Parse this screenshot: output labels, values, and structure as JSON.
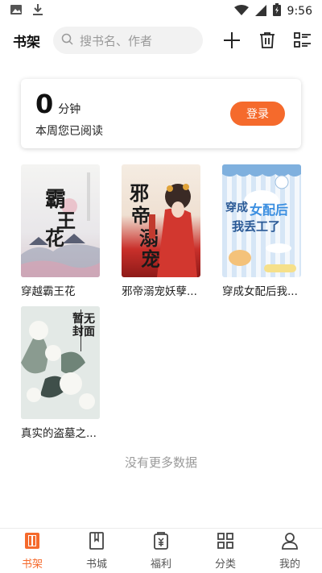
{
  "status_bar": {
    "time": "9:56"
  },
  "header": {
    "title": "书架",
    "search_placeholder": "搜书名、作者"
  },
  "reading_card": {
    "minutes": "0",
    "unit": "分钟",
    "week_label": "本周您已阅读",
    "login_label": "登录"
  },
  "books": [
    {
      "title": "穿越霸王花",
      "cover_text": "霸王花"
    },
    {
      "title": "邪帝溺宠妖孽...",
      "cover_text": "邪帝溺宠"
    },
    {
      "title": "穿成女配后我...",
      "cover_text": "穿成女配后我丢工了"
    },
    {
      "title": "真实的盗墓之...",
      "cover_text": "暂无封面"
    }
  ],
  "footer_text": "没有更多数据",
  "bottom_nav": [
    {
      "label": "书架",
      "icon": "bookshelf-icon",
      "active": true
    },
    {
      "label": "书城",
      "icon": "bookstore-icon",
      "active": false
    },
    {
      "label": "福利",
      "icon": "welfare-icon",
      "active": false
    },
    {
      "label": "分类",
      "icon": "category-icon",
      "active": false
    },
    {
      "label": "我的",
      "icon": "profile-icon",
      "active": false
    }
  ],
  "colors": {
    "accent": "#f56a2c",
    "text": "#222222",
    "muted": "#9a9a9a"
  }
}
